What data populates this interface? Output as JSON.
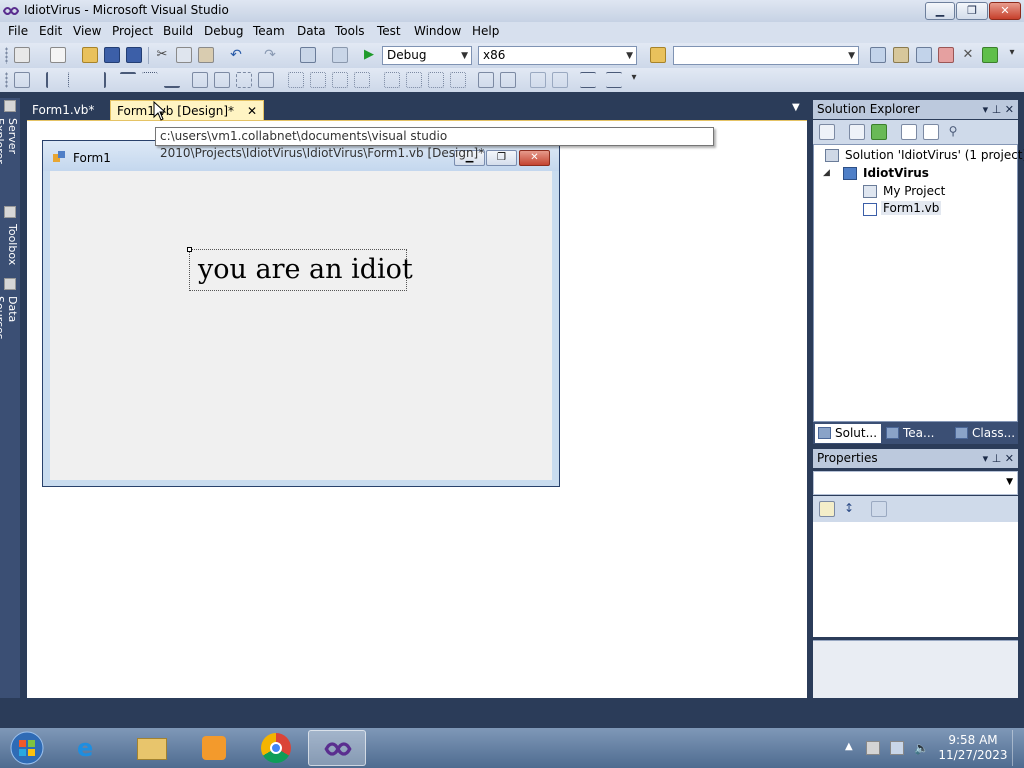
{
  "window": {
    "title": "IdiotVirus - Microsoft Visual Studio"
  },
  "menu": [
    "File",
    "Edit",
    "View",
    "Project",
    "Build",
    "Debug",
    "Team",
    "Data",
    "Tools",
    "Test",
    "Window",
    "Help"
  ],
  "toolbar": {
    "config": "Debug",
    "platform": "x86",
    "find": ""
  },
  "left_strip": [
    "Server Explorer",
    "Toolbox",
    "Data Sources"
  ],
  "doc_tabs": [
    {
      "label": "Form1.vb*"
    },
    {
      "label": "Form1.vb [Design]*",
      "close": "✕"
    }
  ],
  "tooltip": "c:\\users\\vm1.collabnet\\documents\\visual studio 2010\\Projects\\IdiotVirus\\IdiotVirus\\Form1.vb [Design]*",
  "designer": {
    "form_title": "Form1",
    "label_text": "you are an idiot"
  },
  "solution_explorer": {
    "title": "Solution Explorer",
    "solution": "Solution 'IdiotVirus' (1 project)",
    "project": "IdiotVirus",
    "items": [
      "My Project",
      "Form1.vb"
    ],
    "tabs": [
      "Solut...",
      "Tea...",
      "Class..."
    ]
  },
  "properties": {
    "title": "Properties"
  },
  "taskbar": {
    "time": "9:58 AM",
    "date": "11/27/2023"
  },
  "colors": {
    "accent_tab": "#fff4c3",
    "panel_header": "#bcc9dd",
    "chrome_dark": "#2b3c59"
  }
}
